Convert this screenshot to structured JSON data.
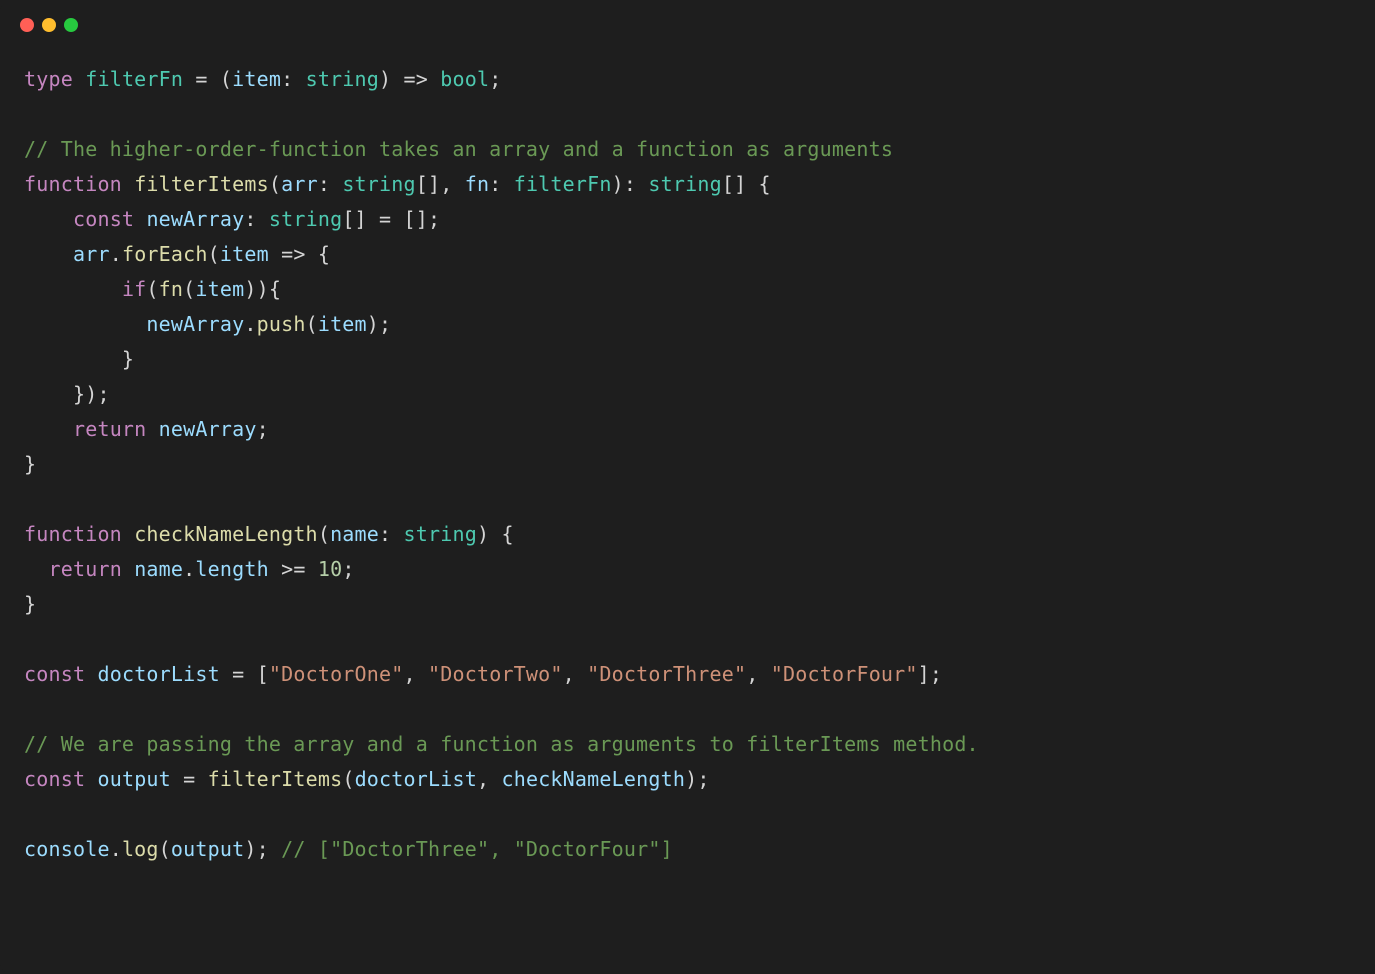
{
  "window": {
    "traffic_lights": [
      "close",
      "minimize",
      "zoom"
    ]
  },
  "code": {
    "lines": [
      [
        {
          "cls": "kw",
          "t": "type"
        },
        {
          "cls": "punct",
          "t": " "
        },
        {
          "cls": "type",
          "t": "filterFn"
        },
        {
          "cls": "punct",
          "t": " = ("
        },
        {
          "cls": "ident",
          "t": "item"
        },
        {
          "cls": "punct",
          "t": ": "
        },
        {
          "cls": "type",
          "t": "string"
        },
        {
          "cls": "punct",
          "t": ") => "
        },
        {
          "cls": "type",
          "t": "bool"
        },
        {
          "cls": "punct",
          "t": ";"
        }
      ],
      [],
      [
        {
          "cls": "comment",
          "t": "// The higher-order-function takes an array and a function as arguments"
        }
      ],
      [
        {
          "cls": "kw",
          "t": "function"
        },
        {
          "cls": "punct",
          "t": " "
        },
        {
          "cls": "fn",
          "t": "filterItems"
        },
        {
          "cls": "punct",
          "t": "("
        },
        {
          "cls": "ident",
          "t": "arr"
        },
        {
          "cls": "punct",
          "t": ": "
        },
        {
          "cls": "type",
          "t": "string"
        },
        {
          "cls": "punct",
          "t": "[], "
        },
        {
          "cls": "ident",
          "t": "fn"
        },
        {
          "cls": "punct",
          "t": ": "
        },
        {
          "cls": "type",
          "t": "filterFn"
        },
        {
          "cls": "punct",
          "t": "): "
        },
        {
          "cls": "type",
          "t": "string"
        },
        {
          "cls": "punct",
          "t": "[] {"
        }
      ],
      [
        {
          "cls": "punct",
          "t": "    "
        },
        {
          "cls": "kw",
          "t": "const"
        },
        {
          "cls": "punct",
          "t": " "
        },
        {
          "cls": "ident",
          "t": "newArray"
        },
        {
          "cls": "punct",
          "t": ": "
        },
        {
          "cls": "type",
          "t": "string"
        },
        {
          "cls": "punct",
          "t": "[] = [];"
        }
      ],
      [
        {
          "cls": "punct",
          "t": "    "
        },
        {
          "cls": "ident",
          "t": "arr"
        },
        {
          "cls": "punct",
          "t": "."
        },
        {
          "cls": "fn",
          "t": "forEach"
        },
        {
          "cls": "punct",
          "t": "("
        },
        {
          "cls": "ident",
          "t": "item"
        },
        {
          "cls": "punct",
          "t": " => {"
        }
      ],
      [
        {
          "cls": "punct",
          "t": "        "
        },
        {
          "cls": "kw",
          "t": "if"
        },
        {
          "cls": "punct",
          "t": "("
        },
        {
          "cls": "fn",
          "t": "fn"
        },
        {
          "cls": "punct",
          "t": "("
        },
        {
          "cls": "ident",
          "t": "item"
        },
        {
          "cls": "punct",
          "t": ")){"
        }
      ],
      [
        {
          "cls": "punct",
          "t": "          "
        },
        {
          "cls": "ident",
          "t": "newArray"
        },
        {
          "cls": "punct",
          "t": "."
        },
        {
          "cls": "fn",
          "t": "push"
        },
        {
          "cls": "punct",
          "t": "("
        },
        {
          "cls": "ident",
          "t": "item"
        },
        {
          "cls": "punct",
          "t": ");"
        }
      ],
      [
        {
          "cls": "punct",
          "t": "        }"
        }
      ],
      [
        {
          "cls": "punct",
          "t": "    });"
        }
      ],
      [
        {
          "cls": "punct",
          "t": "    "
        },
        {
          "cls": "kw",
          "t": "return"
        },
        {
          "cls": "punct",
          "t": " "
        },
        {
          "cls": "ident",
          "t": "newArray"
        },
        {
          "cls": "punct",
          "t": ";"
        }
      ],
      [
        {
          "cls": "punct",
          "t": "}"
        }
      ],
      [],
      [
        {
          "cls": "kw",
          "t": "function"
        },
        {
          "cls": "punct",
          "t": " "
        },
        {
          "cls": "fn",
          "t": "checkNameLength"
        },
        {
          "cls": "punct",
          "t": "("
        },
        {
          "cls": "ident",
          "t": "name"
        },
        {
          "cls": "punct",
          "t": ": "
        },
        {
          "cls": "type",
          "t": "string"
        },
        {
          "cls": "punct",
          "t": ") {"
        }
      ],
      [
        {
          "cls": "punct",
          "t": "  "
        },
        {
          "cls": "kw",
          "t": "return"
        },
        {
          "cls": "punct",
          "t": " "
        },
        {
          "cls": "ident",
          "t": "name"
        },
        {
          "cls": "punct",
          "t": "."
        },
        {
          "cls": "ident",
          "t": "length"
        },
        {
          "cls": "punct",
          "t": " >= "
        },
        {
          "cls": "num",
          "t": "10"
        },
        {
          "cls": "punct",
          "t": ";"
        }
      ],
      [
        {
          "cls": "punct",
          "t": "}"
        }
      ],
      [],
      [
        {
          "cls": "kw",
          "t": "const"
        },
        {
          "cls": "punct",
          "t": " "
        },
        {
          "cls": "ident",
          "t": "doctorList"
        },
        {
          "cls": "punct",
          "t": " = ["
        },
        {
          "cls": "str",
          "t": "\"DoctorOne\""
        },
        {
          "cls": "punct",
          "t": ", "
        },
        {
          "cls": "str",
          "t": "\"DoctorTwo\""
        },
        {
          "cls": "punct",
          "t": ", "
        },
        {
          "cls": "str",
          "t": "\"DoctorThree\""
        },
        {
          "cls": "punct",
          "t": ", "
        },
        {
          "cls": "str",
          "t": "\"DoctorFour\""
        },
        {
          "cls": "punct",
          "t": "];"
        }
      ],
      [],
      [
        {
          "cls": "comment",
          "t": "// We are passing the array and a function as arguments to filterItems method."
        }
      ],
      [
        {
          "cls": "kw",
          "t": "const"
        },
        {
          "cls": "punct",
          "t": " "
        },
        {
          "cls": "ident",
          "t": "output"
        },
        {
          "cls": "punct",
          "t": " = "
        },
        {
          "cls": "fn",
          "t": "filterItems"
        },
        {
          "cls": "punct",
          "t": "("
        },
        {
          "cls": "ident",
          "t": "doctorList"
        },
        {
          "cls": "punct",
          "t": ", "
        },
        {
          "cls": "ident",
          "t": "checkNameLength"
        },
        {
          "cls": "punct",
          "t": ");"
        }
      ],
      [],
      [
        {
          "cls": "ident",
          "t": "console"
        },
        {
          "cls": "punct",
          "t": "."
        },
        {
          "cls": "fn",
          "t": "log"
        },
        {
          "cls": "punct",
          "t": "("
        },
        {
          "cls": "ident",
          "t": "output"
        },
        {
          "cls": "punct",
          "t": "); "
        },
        {
          "cls": "comment",
          "t": "// [\"DoctorThree\", \"DoctorFour\"]"
        }
      ]
    ]
  }
}
